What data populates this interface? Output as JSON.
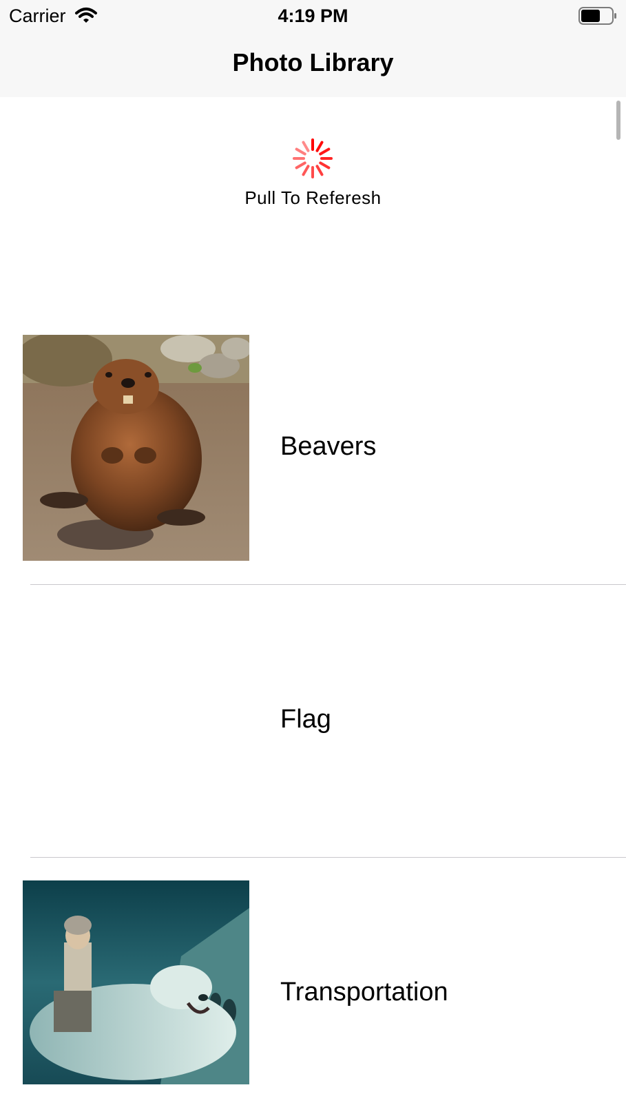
{
  "status_bar": {
    "carrier": "Carrier",
    "time": "4:19 PM",
    "wifi_icon": "wifi-icon",
    "battery_icon": "battery-icon"
  },
  "nav": {
    "title": "Photo Library"
  },
  "refresh": {
    "label": "Pull To Referesh",
    "spinner_icon": "activity-spinner-icon",
    "spinner_color": "#ff0000"
  },
  "list": {
    "items": [
      {
        "title": "Beavers",
        "image": "beaver-photo",
        "has_image": true
      },
      {
        "title": "Flag",
        "image": "",
        "has_image": false
      },
      {
        "title": "Transportation",
        "image": "girl-riding-polar-bear-photo",
        "has_image": true
      }
    ]
  },
  "colors": {
    "nav_background": "#f7f7f7",
    "separator": "#c8c7cc",
    "spinner": "#ff0000"
  }
}
